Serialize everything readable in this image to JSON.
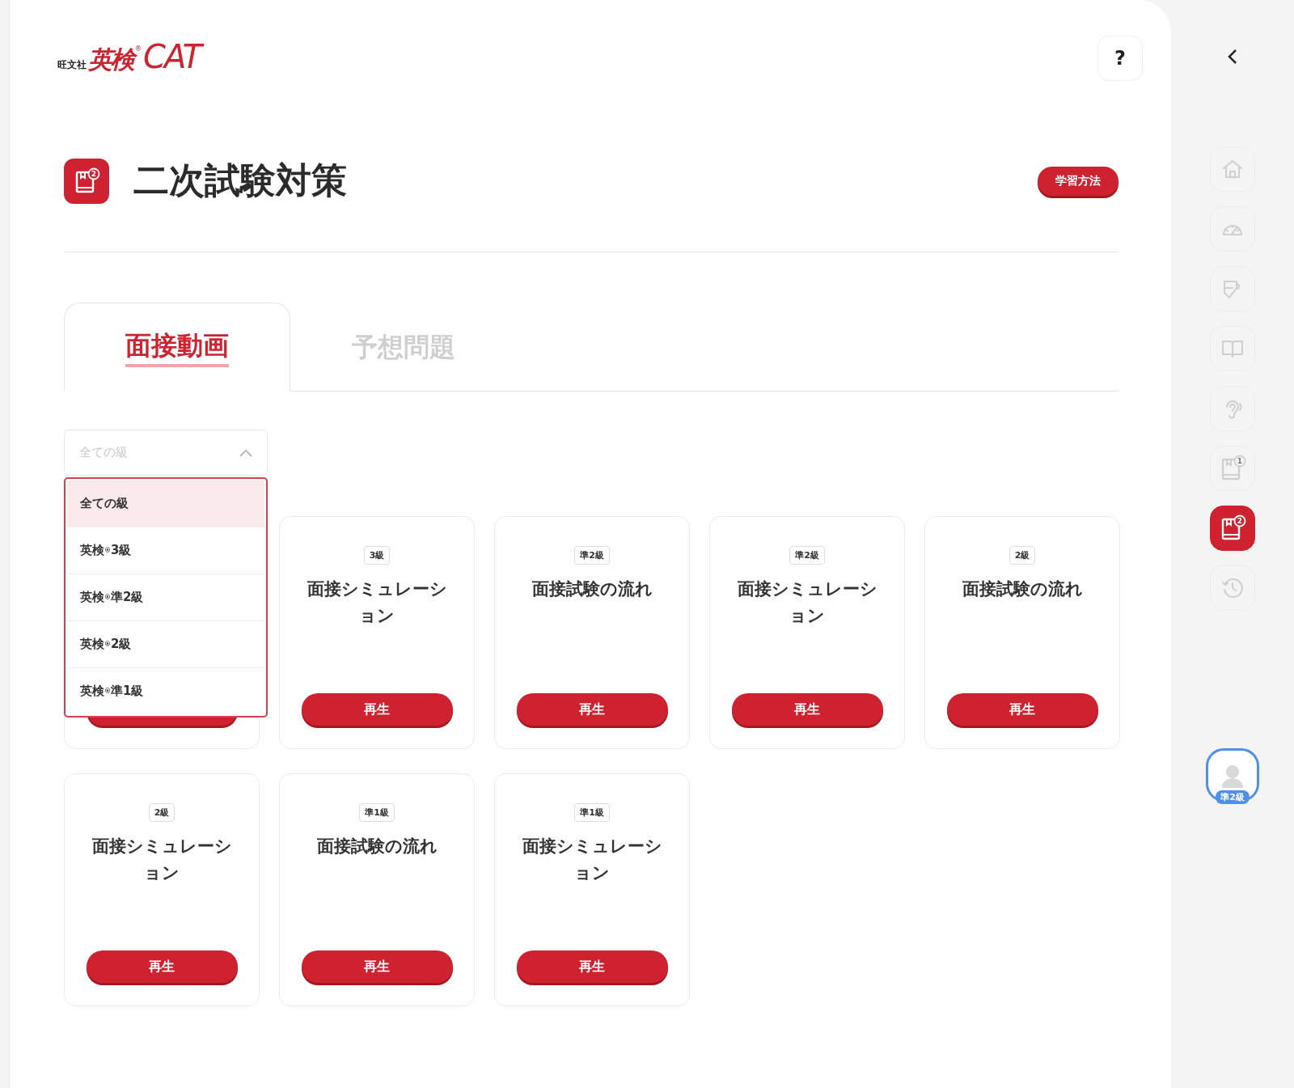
{
  "logo": {
    "publisher": "旺文社",
    "brand": "英検",
    "mark": "®",
    "product": "CAT"
  },
  "help_button": "?",
  "page": {
    "icon_badge": "2",
    "title": "二次試験対策",
    "study_button": "学習方法"
  },
  "tabs": [
    {
      "label": "面接動画",
      "selected": true
    },
    {
      "label": "予想問題",
      "selected": false
    }
  ],
  "grade_filter": {
    "placeholder": "全ての級",
    "expanded": true,
    "options": [
      {
        "label": "全ての級",
        "selected": true
      },
      {
        "label": "英検$^{®}$3級",
        "selected": false
      },
      {
        "label": "英検$^{®}$準2級",
        "selected": false
      },
      {
        "label": "英検$^{®}$2級",
        "selected": false
      },
      {
        "label": "英検$^{®}$準1級",
        "selected": false
      }
    ]
  },
  "videos": [
    {
      "kind": "covered"
    },
    {
      "kind": "card",
      "grade": "3級",
      "title": "面接シミュレーション",
      "button": "再生"
    },
    {
      "kind": "card",
      "grade": "準2級",
      "title": "面接試験の流れ",
      "button": "再生"
    },
    {
      "kind": "card",
      "grade": "準2級",
      "title": "面接シミュレーション",
      "button": "再生"
    },
    {
      "kind": "card",
      "grade": "2級",
      "title": "面接試験の流れ",
      "button": "再生"
    },
    {
      "kind": "card",
      "grade": "2級",
      "title": "面接シミュレーション",
      "button": "再生"
    },
    {
      "kind": "card",
      "grade": "準1級",
      "title": "面接試験の流れ",
      "button": "再生"
    },
    {
      "kind": "card",
      "grade": "準1級",
      "title": "面接シミュレーション",
      "button": "再生"
    }
  ],
  "sidebar": {
    "items": [
      {
        "kind": "home",
        "selected": false
      },
      {
        "kind": "gauge",
        "selected": false
      },
      {
        "kind": "tag",
        "selected": false
      },
      {
        "kind": "book",
        "selected": false
      },
      {
        "kind": "ear",
        "selected": false
      },
      {
        "kind": "notebook",
        "badge": "1",
        "selected": false
      },
      {
        "kind": "notebook",
        "badge": "2",
        "selected": true
      },
      {
        "kind": "history",
        "selected": false
      }
    ],
    "user_grade": "準2級"
  }
}
